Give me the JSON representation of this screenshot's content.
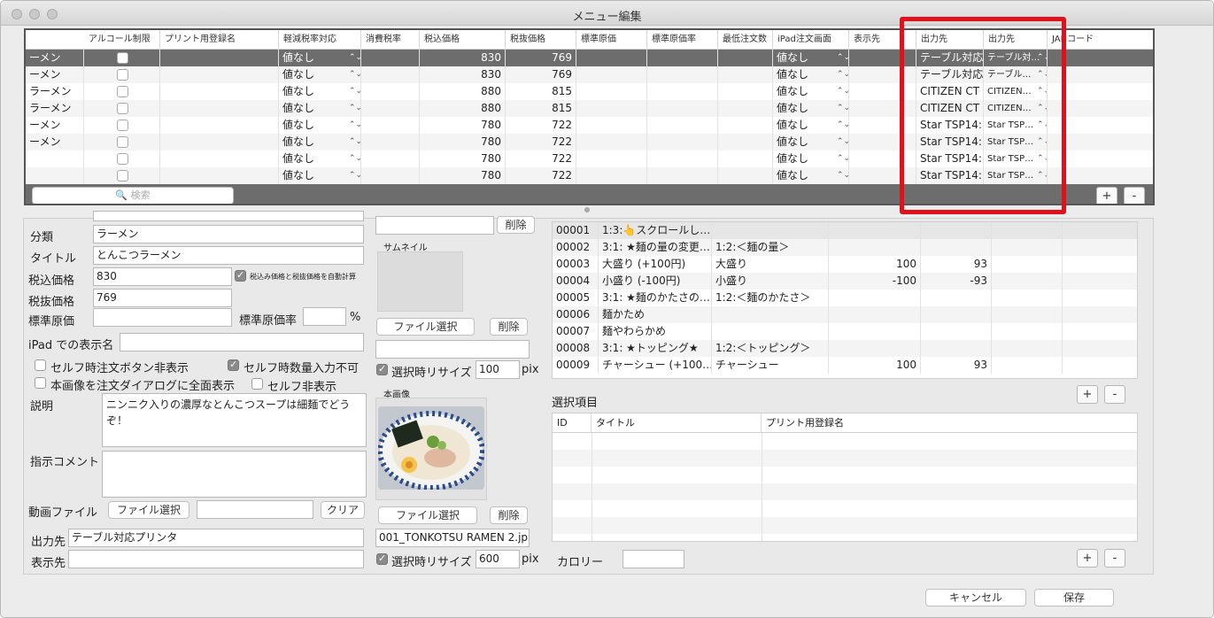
{
  "window": {
    "title": "メニュー編集"
  },
  "table": {
    "headers": [
      "アルコール制限",
      "プリント用登録名",
      "軽減税率対応",
      "消費税率",
      "税込価格",
      "税抜価格",
      "標準原価",
      "標準原価率",
      "最低注文数",
      "iPad注文画面",
      "表示先",
      "出力先",
      "出力先",
      "JANコード"
    ],
    "rows": [
      {
        "name": "ーメン",
        "tax": "値なし",
        "incl": "830",
        "excl": "769",
        "ipad": "値なし",
        "out1": "テーブル対応",
        "out2": "テーブル対…"
      },
      {
        "name": "ーメン",
        "tax": "値なし",
        "incl": "830",
        "excl": "769",
        "ipad": "値なし",
        "out1": "テーブル対応",
        "out2": "テーブル…"
      },
      {
        "name": "ラーメン",
        "tax": "値なし",
        "incl": "880",
        "excl": "815",
        "ipad": "値なし",
        "out1": "CITIZEN CT",
        "out2": "CITIZEN…"
      },
      {
        "name": "ラーメン",
        "tax": "値なし",
        "incl": "880",
        "excl": "815",
        "ipad": "値なし",
        "out1": "CITIZEN CT",
        "out2": "CITIZEN…"
      },
      {
        "name": "ーメン",
        "tax": "値なし",
        "incl": "780",
        "excl": "722",
        "ipad": "値なし",
        "out1": "Star TSP14:",
        "out2": "Star TSP…"
      },
      {
        "name": "ーメン",
        "tax": "値なし",
        "incl": "780",
        "excl": "722",
        "ipad": "値なし",
        "out1": "Star TSP14:",
        "out2": "Star TSP…"
      },
      {
        "name": "",
        "tax": "値なし",
        "incl": "780",
        "excl": "722",
        "ipad": "値なし",
        "out1": "Star TSP14:",
        "out2": "Star TSP…"
      },
      {
        "name": "",
        "tax": "値なし",
        "incl": "780",
        "excl": "722",
        "ipad": "値なし",
        "out1": "Star TSP14:",
        "out2": "Star TSP…"
      }
    ],
    "search_placeholder": "検索",
    "add": "+",
    "remove": "-"
  },
  "form": {
    "category_label": "分類",
    "category": "ラーメン",
    "title_label": "タイトル",
    "title": "とんこつラーメン",
    "incl_label": "税込価格",
    "incl": "830",
    "auto_calc": "税込み価格と税抜価格を自動計算",
    "excl_label": "税抜価格",
    "excl": "769",
    "cost_label": "標準原価",
    "cost_rate_label": "標準原価率",
    "percent": "%",
    "ipad_name_label": "iPad での表示名",
    "self_hide": "セルフ時注文ボタン非表示",
    "self_qty": "セルフ時数量入力不可",
    "fullscreen": "本画像を注文ダイアログに全面表示",
    "self_hidden": "セルフ非表示",
    "desc_label": "説明",
    "desc": "ニンニク入りの濃厚なとんこつスープは細麺でどうぞ！",
    "comment_label": "指示コメント",
    "video_label": "動画ファイル",
    "file_select": "ファイル選択",
    "clear": "クリア",
    "output_label": "出力先",
    "output": "テーブル対応プリンタ",
    "display_label": "表示先"
  },
  "images": {
    "delete": "削除",
    "thumb_label": "サムネイル",
    "file_select": "ファイル選択",
    "resize": "選択時リサイズ",
    "resize_thumb": "100",
    "pix": "pix",
    "main_label": "本画像",
    "main_file": "001_TONKOTSU RAMEN 2.jp",
    "resize_main": "600"
  },
  "options": {
    "rows": [
      {
        "id": "00001",
        "title": "1:3:👆スクロールし…",
        "sub": "",
        "p1": "",
        "p2": ""
      },
      {
        "id": "00002",
        "title": "3:1: ★麺の量の変更…",
        "sub": "1:2:＜麺の量＞",
        "p1": "",
        "p2": ""
      },
      {
        "id": "00003",
        "title": "大盛り (+100円)",
        "sub": "大盛り",
        "p1": "100",
        "p2": "93"
      },
      {
        "id": "00004",
        "title": "小盛り (-100円)",
        "sub": "小盛り",
        "p1": "-100",
        "p2": "-93"
      },
      {
        "id": "00005",
        "title": "3:1: ★麺のかたさの…",
        "sub": "1:2:＜麺のかたさ＞",
        "p1": "",
        "p2": ""
      },
      {
        "id": "00006",
        "title": "麺かため",
        "sub": "",
        "p1": "",
        "p2": ""
      },
      {
        "id": "00007",
        "title": "麺やわらかめ",
        "sub": "",
        "p1": "",
        "p2": ""
      },
      {
        "id": "00008",
        "title": "3:1: ★トッピング★",
        "sub": "1:2:＜トッピング＞",
        "p1": "",
        "p2": ""
      },
      {
        "id": "00009",
        "title": "チャーシュー (+100…",
        "sub": "チャーシュー",
        "p1": "100",
        "p2": "93"
      }
    ]
  },
  "selection": {
    "label": "選択項目",
    "headers": [
      "ID",
      "タイトル",
      "プリント用登録名"
    ],
    "calorie_label": "カロリー"
  },
  "footer": {
    "cancel": "キャンセル",
    "save": "保存"
  }
}
